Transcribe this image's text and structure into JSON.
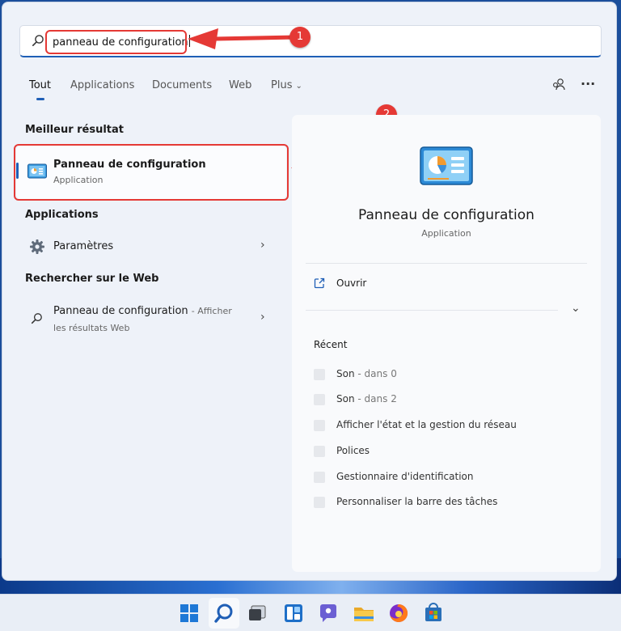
{
  "search": {
    "query": "panneau de configuration",
    "icon": "search-icon"
  },
  "tabs": [
    {
      "label": "Tout",
      "active": true
    },
    {
      "label": "Applications",
      "active": false
    },
    {
      "label": "Documents",
      "active": false
    },
    {
      "label": "Web",
      "active": false
    },
    {
      "label": "Plus",
      "active": false
    }
  ],
  "toolbar": {
    "account_icon": "account-switch-icon",
    "more_label": "···"
  },
  "best_match": {
    "heading": "Meilleur résultat",
    "title": "Panneau de configuration",
    "subtitle": "Application",
    "icon": "control-panel-icon"
  },
  "apps": {
    "heading": "Applications",
    "items": [
      {
        "label": "Paramètres",
        "icon": "settings-gear-icon",
        "arrow": "›"
      }
    ]
  },
  "web": {
    "heading": "Rechercher sur le Web",
    "title": "Panneau de configuration",
    "suffix": "- Afficher",
    "subtitle": "les résultats Web",
    "arrow": "›"
  },
  "preview": {
    "title": "Panneau de configuration",
    "subtitle": "Application",
    "open_label": "Ouvrir",
    "expand_icon": "chevron-down-icon",
    "recent_heading": "Récent",
    "recent": [
      {
        "label": "Son",
        "detail": "- dans 0"
      },
      {
        "label": "Son",
        "detail": "- dans 2"
      },
      {
        "label": "Afficher l'état et la gestion du réseau",
        "detail": ""
      },
      {
        "label": "Polices",
        "detail": ""
      },
      {
        "label": "Gestionnaire d'identification",
        "detail": ""
      },
      {
        "label": "Personnaliser la barre des tâches",
        "detail": ""
      }
    ]
  },
  "annotations": {
    "badge1": "1",
    "badge2": "2",
    "color": "#e53935"
  },
  "taskbar": {
    "icons": [
      "windows-start-icon",
      "search-icon",
      "task-view-icon",
      "widgets-icon",
      "teams-chat-icon",
      "file-explorer-icon",
      "firefox-icon",
      "microsoft-store-icon"
    ]
  },
  "colors": {
    "accent": "#1f5fb6",
    "panel_bg": "#eef2f9",
    "annotation_red": "#e53935"
  }
}
